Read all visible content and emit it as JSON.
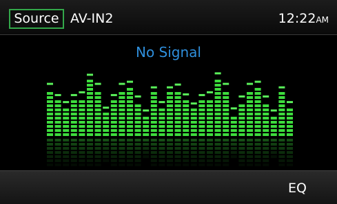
{
  "header": {
    "source_label": "Source",
    "source_name": "AV-IN2",
    "time": "12:22",
    "ampm": "AM"
  },
  "main": {
    "status": "No Signal"
  },
  "visualizer": {
    "bar_color": "#3ddc3d",
    "peak_color": "#5af05a",
    "levels": [
      0.7,
      0.54,
      0.44,
      0.54,
      0.58,
      0.83,
      0.7,
      0.36,
      0.54,
      0.7,
      0.73,
      0.52,
      0.32,
      0.65,
      0.44,
      0.65,
      0.69,
      0.55,
      0.42,
      0.54,
      0.58,
      0.85,
      0.7,
      0.35,
      0.52,
      0.7,
      0.73,
      0.52,
      0.32,
      0.65,
      0.44
    ]
  },
  "footer": {
    "eq_label": "EQ"
  }
}
